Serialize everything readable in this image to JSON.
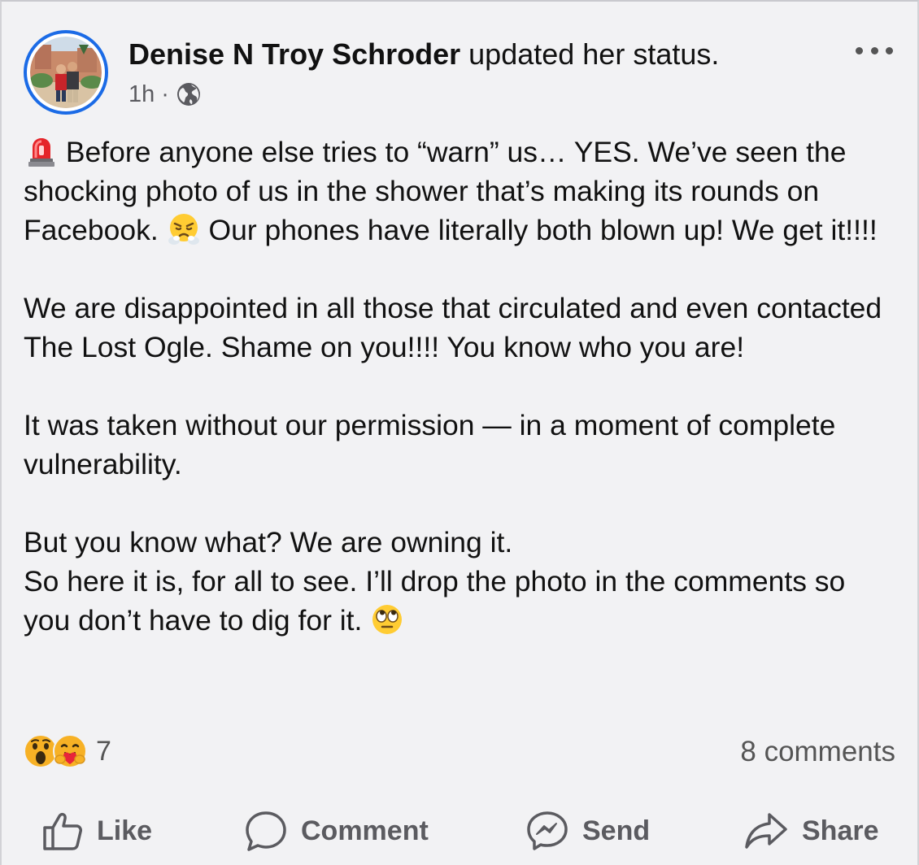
{
  "post": {
    "author_name": "Denise N Troy Schroder",
    "author_action": "updated her status.",
    "timestamp": "1h",
    "separator": "·",
    "audience_icon": "globe-icon",
    "more_icon": "more-horizontal-icon"
  },
  "body": {
    "p1_text": "Before anyone else tries to “warn” us… YES. We’ve seen the shocking photo of us in the shower that’s making its rounds on Facebook.",
    "p1_text2": "Our phones have literally both blown up! We get it!!!!",
    "p1_emoji_start": "police-light-emoji",
    "p1_emoji_mid": "steam-face-emoji",
    "p2_text": "We are disappointed  in all those that circulated and even contacted The Lost Ogle. Shame on you!!!! You know who you are!",
    "p3_text": "It was taken without our permission — in a moment of complete vulnerability.",
    "p4_line1": "But you know what? We are owning it.",
    "p4_line2": "So here it is, for all to see. I’ll drop the photo in the comments so you don’t have to dig for it.",
    "p4_emoji_end": "eye-roll-emoji"
  },
  "stats": {
    "reaction_icons": [
      "wow-icon",
      "care-icon"
    ],
    "reaction_count": "7",
    "comments_label": "8 comments"
  },
  "actions": {
    "like": "Like",
    "comment": "Comment",
    "send": "Send",
    "share": "Share"
  },
  "colors": {
    "accent": "#1b6be6",
    "background": "#f2f2f4",
    "muted_text": "#5a5a5f"
  }
}
